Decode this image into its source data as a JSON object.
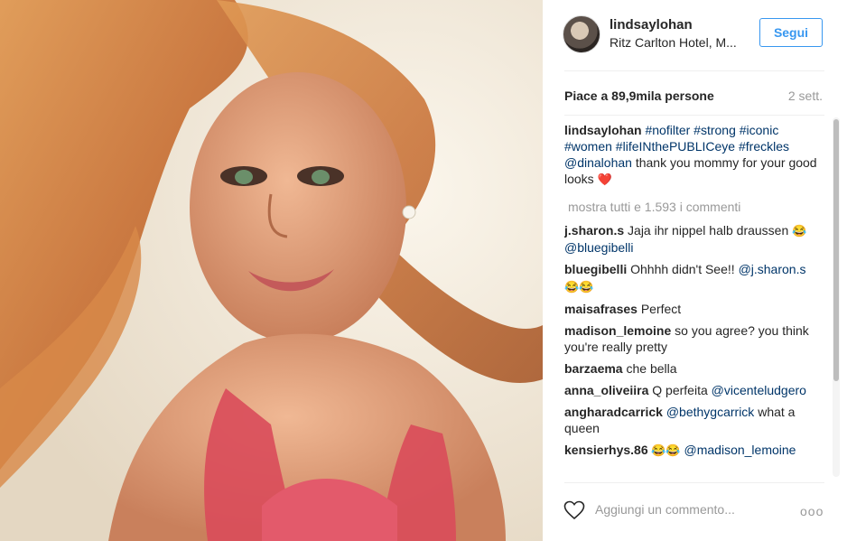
{
  "post": {
    "username": "lindsaylohan",
    "location": "Ritz Carlton Hotel, M...",
    "follow_label": "Segui",
    "likes": "Piace a 89,9mila persone",
    "time_ago": "2 sett."
  },
  "caption": {
    "user": "lindsaylohan",
    "hashtags": "#nofilter #strong #iconic #women #lifeINthePUBLICeye #freckles @dinalohan",
    "text": " thank you mommy for your good looks ",
    "emoji": "❤️"
  },
  "view_all_comments": "mostra tutti e 1.593 i commenti",
  "comments": [
    {
      "user": "j.sharon.s",
      "text": " Jaja ihr nippel halb draussen ",
      "emoji": "😂",
      "mention": " @bluegibelli"
    },
    {
      "user": "bluegibelli",
      "text": " Ohhhh didn't See!! ",
      "mention": "@j.sharon.s",
      "emoji": " 😂😂"
    },
    {
      "user": "maisafrases",
      "text": " Perfect"
    },
    {
      "user": "madison_lemoine",
      "text": " so you agree? you think you're really pretty"
    },
    {
      "user": "barzaema",
      "text": " che bella"
    },
    {
      "user": "anna_oliveiira",
      "text": " Q perfeita ",
      "mention": "@vicenteludgero"
    },
    {
      "user": "angharadcarrick",
      "mention": " @bethygcarrick",
      "text": " what a queen"
    },
    {
      "user": "kensierhys.86",
      "emoji": " 😂😂",
      "mention": " @madison_lemoine"
    }
  ],
  "add_comment_placeholder": "Aggiungi un commento...",
  "more_options": "ooo",
  "icons": {
    "like": "heart-icon",
    "options": "more-options-icon"
  },
  "colors": {
    "accent": "#3897f0",
    "link": "#003569",
    "muted": "#999999"
  }
}
